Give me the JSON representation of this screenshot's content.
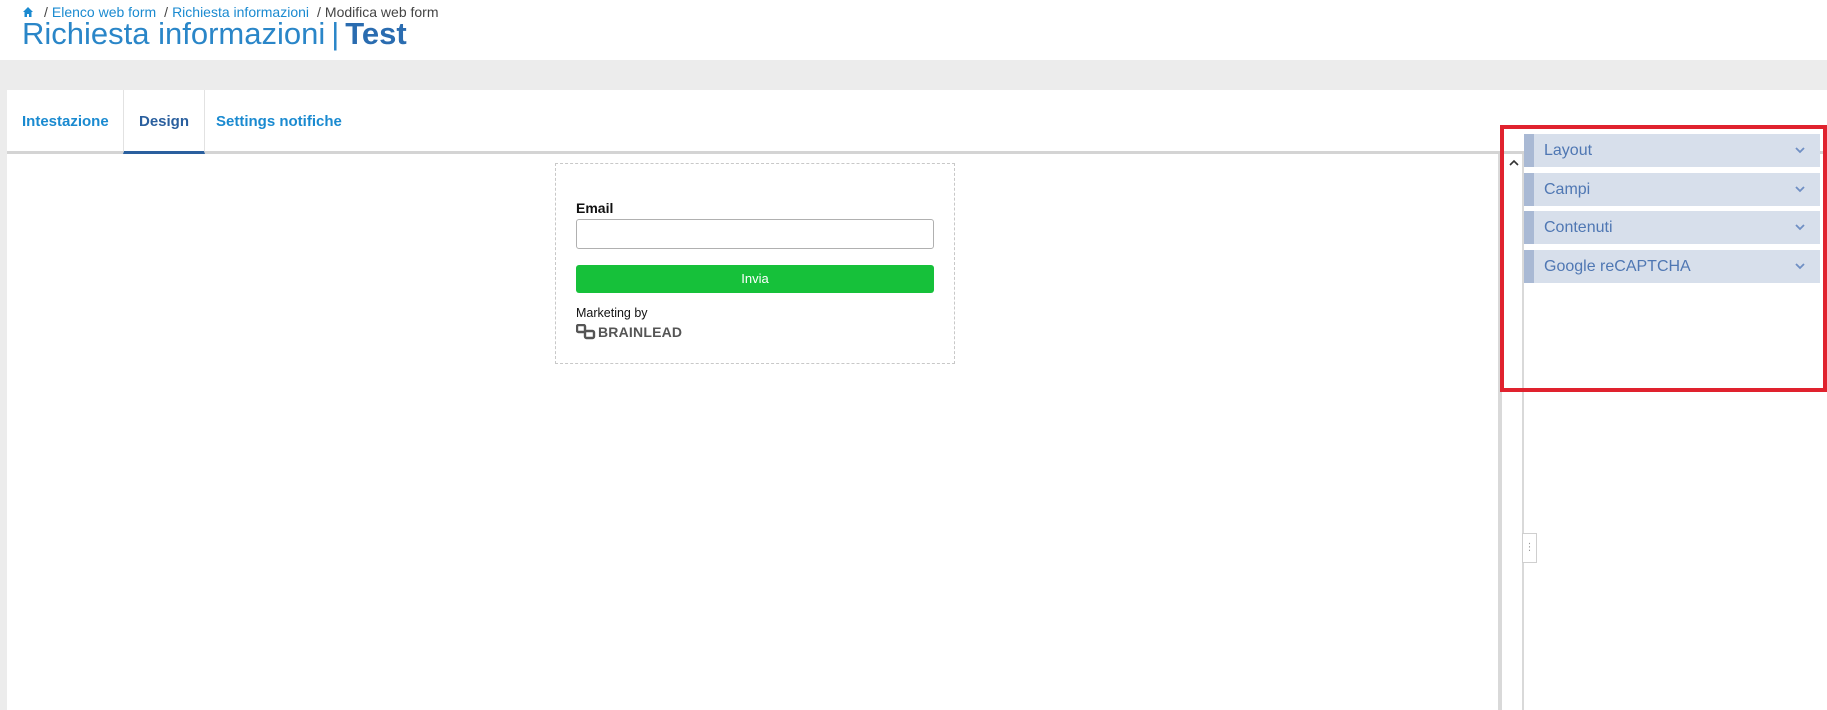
{
  "breadcrumb": {
    "items": [
      "Elenco web form",
      "Richiesta informazioni"
    ],
    "current": "Modifica web form",
    "separator": "/"
  },
  "title": {
    "main": "Richiesta informazioni",
    "separator": "|",
    "emphasis": "Test"
  },
  "tabs": [
    {
      "label": "Intestazione",
      "active": false
    },
    {
      "label": "Design",
      "active": true
    },
    {
      "label": "Settings notifiche",
      "active": false
    }
  ],
  "form": {
    "email_label": "Email",
    "email_value": "",
    "submit_label": "Invia",
    "marketing_label": "Marketing by",
    "brand_name": "BRAINLEAD"
  },
  "sidebar": {
    "sections": [
      {
        "label": "Layout",
        "icon": "chevron-down-icon"
      },
      {
        "label": "Campi",
        "icon": "chevron-down-icon"
      },
      {
        "label": "Contenuti",
        "icon": "chevron-down-icon"
      },
      {
        "label": "Google reCAPTCHA",
        "icon": "chevron-down-icon"
      }
    ]
  },
  "colors": {
    "link": "#1a8ad0",
    "title": "#2a86c8",
    "active_tab": "#2a5f9e",
    "submit": "#16c13a",
    "accordion_bg": "#d7dfeb",
    "accordion_text": "#4f77b3",
    "highlight": "#e0222e"
  }
}
